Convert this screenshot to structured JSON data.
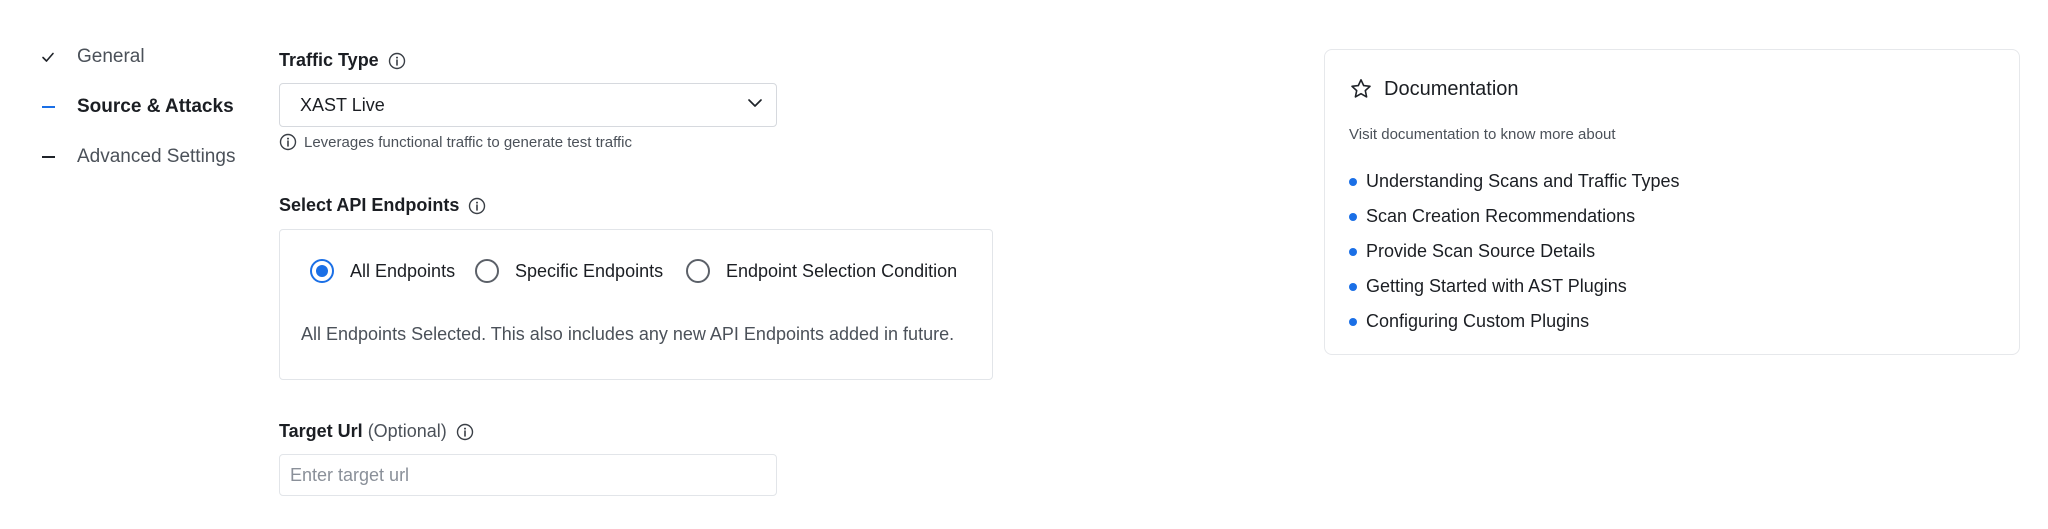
{
  "steps": [
    {
      "label": "General",
      "state": "done",
      "icon": "check-icon"
    },
    {
      "label": "Source & Attacks",
      "state": "active",
      "icon": "dash-icon"
    },
    {
      "label": "Advanced Settings",
      "state": "pending",
      "icon": "dash-icon"
    }
  ],
  "traffic": {
    "label": "Traffic Type",
    "selected": "XAST Live",
    "hint": "Leverages functional traffic to generate test traffic"
  },
  "endpoints": {
    "label": "Select API Endpoints",
    "options": [
      {
        "label": "All Endpoints",
        "checked": true
      },
      {
        "label": "Specific Endpoints",
        "checked": false
      },
      {
        "label": "Endpoint Selection Condition",
        "checked": false
      }
    ],
    "description": "All Endpoints Selected. This also includes any new API Endpoints added in future."
  },
  "target": {
    "label": "Target Url",
    "optional": "(Optional)",
    "placeholder": "Enter target url",
    "value": ""
  },
  "documentation": {
    "title": "Documentation",
    "subtitle": "Visit documentation to know more about",
    "links": [
      "Understanding Scans and Traffic Types",
      "Scan Creation Recommendations",
      "Provide Scan Source Details",
      "Getting Started with AST Plugins",
      "Configuring Custom Plugins"
    ]
  },
  "colors": {
    "accent": "#1a6fe6",
    "text": "#1b1e23",
    "muted": "#4b5159",
    "border": "#e2e5e9"
  }
}
